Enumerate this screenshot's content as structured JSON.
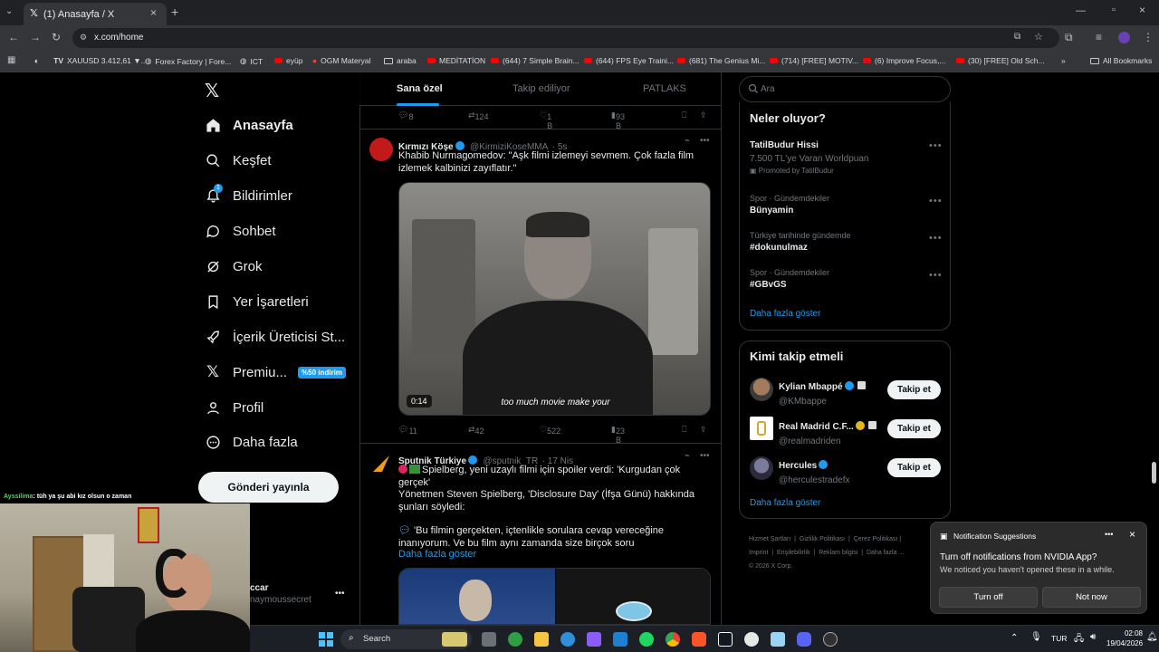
{
  "browser": {
    "tab_title": "(1) Anasayfa / X",
    "url": "x.com/home",
    "bookmarks": [
      "XAUUSD 3.412,61 ▼...",
      "Forex Factory | Fore...",
      "ICT",
      "eyüp",
      "OGM Materyal",
      "araba",
      "MEDİTATİON",
      "(644) 7 Simple Brain...",
      "(644) FPS Eye Traini...",
      "(681) The Genius Mi...",
      "(714) [FREE] MOTIV...",
      "(6) Improve Focus,...",
      "(30) [FREE] Old Sch..."
    ],
    "all_bookmarks": "All Bookmarks"
  },
  "sidebar": {
    "items": [
      {
        "label": "Anasayfa",
        "icon": "home-icon"
      },
      {
        "label": "Keşfet",
        "icon": "search-icon"
      },
      {
        "label": "Bildirimler",
        "icon": "bell-icon",
        "badge": "1"
      },
      {
        "label": "Sohbet",
        "icon": "chat-icon"
      },
      {
        "label": "Grok",
        "icon": "grok-icon"
      },
      {
        "label": "Yer İşaretleri",
        "icon": "bookmark-icon"
      },
      {
        "label": "İçerik Üreticisi St...",
        "icon": "rocket-icon"
      },
      {
        "label": "Premiu...",
        "icon": "x-logo-icon",
        "badge": "%50 indirim"
      },
      {
        "label": "Profil",
        "icon": "person-icon"
      },
      {
        "label": "Daha fazla",
        "icon": "more-circle-icon"
      }
    ],
    "post_button": "Gönderi yayınla",
    "account_name": "ccar",
    "account_handle": "naymoussecret"
  },
  "feed": {
    "tabs": [
      "Sana özel",
      "Takip ediliyor",
      "PATLAKS"
    ],
    "prev_actions": {
      "replies": "8",
      "reposts": "124",
      "likes": "1 B",
      "views": "93 B"
    },
    "tweet1": {
      "name": "Kırmızı Köşe",
      "handle": "@KirmiziKoseMMA",
      "time": "· 5s",
      "text": "Khabib Nurmagomedov: \"Aşk filmi izlemeyi sevmem. Çok fazla film izlemek kalbinizi zayıflatır.\"",
      "video_duration": "0:14",
      "caption": "too much movie make your",
      "replies": "11",
      "reposts": "42",
      "likes": "522",
      "views": "23 B"
    },
    "tweet2": {
      "name": "Sputnik Türkiye",
      "handle": "@sputnik_TR",
      "time": "· 17 Nis",
      "line1": "Spielberg, yeni uzaylı filmi için spoiler verdi: 'Kurgudan çok gerçek'",
      "line2": "Yönetmen Steven Spielberg, 'Disclosure Day' (İfşa Günü) hakkında şunları söyledi:",
      "line3": "'Bu filmin gerçekten, içtenlikle sorulara cevap vereceğine inanıyorum. Ve bu film aynı zamanda size birçok soru",
      "more": "Daha fazla göster"
    }
  },
  "right": {
    "search_placeholder": "Ara",
    "trends_title": "Neler oluyor?",
    "promoted": {
      "title": "TatilBudur Hissi",
      "sub": "7.500 TL'ye Varan Worldpuan",
      "by": "Promoted by TatilBudur"
    },
    "trends": [
      {
        "context": "Spor · Gündemdekiler",
        "title": "Bünyamin"
      },
      {
        "context": "Türkiye tarihinde gündemde",
        "title": "#dokunulmaz"
      },
      {
        "context": "Spor · Gündemdekiler",
        "title": "#GBvGS"
      }
    ],
    "trends_more": "Daha fazla göster",
    "who_title": "Kimi takip etmeli",
    "who": [
      {
        "name": "Kylian Mbappé",
        "handle": "@KMbappe",
        "button": "Takip et"
      },
      {
        "name": "Real Madrid C.F...",
        "handle": "@realmadriden",
        "button": "Takip et"
      },
      {
        "name": "Hercules",
        "handle": "@herculestradefx",
        "button": "Takip et"
      }
    ],
    "who_more": "Daha fazla göster",
    "footer": [
      "Hizmet Şartları",
      "Gizlilik Politikası",
      "Çerez Politikası",
      "Imprint",
      "Erişilebilirlik",
      "Reklam bilgisi",
      "Daha fazla ...",
      "© 2026 X Corp."
    ]
  },
  "notification": {
    "header": "Notification Suggestions",
    "line1": "Turn off notifications from NVIDIA App?",
    "line2": "We noticed you haven't opened these in a while.",
    "btn1": "Turn off",
    "btn2": "Not now"
  },
  "stream_chat": {
    "user": "Ayssilima",
    "message": ": tüh ya şu abi kız olsun o zaman"
  },
  "taskbar": {
    "search": "Search",
    "lang": "TUR",
    "time": "02:08",
    "date": "19/04/2026"
  },
  "colors": {
    "accent": "#1d9bf0",
    "background": "#000000",
    "border": "#2f3336"
  }
}
